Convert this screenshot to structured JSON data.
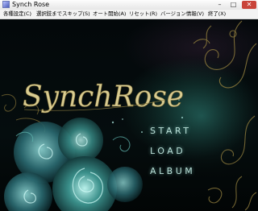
{
  "window": {
    "title": "Synch Rose",
    "controls": {
      "minimize": "–",
      "maximize": "□",
      "close": "✕"
    }
  },
  "menu": [
    "各種設定(C)",
    "選択肢までスキップ(S)",
    "オート開始(A)",
    "リセット(R)",
    "バージョン情報(V)",
    "終了(X)"
  ],
  "game": {
    "logo": "SynchRose",
    "options": {
      "start": "START",
      "load": "LOAD",
      "album": "ALBUM"
    }
  },
  "colors": {
    "logo_gold": "#d9cc92",
    "menu_text": "#b9ded6",
    "rose_teal": "#3a8f8a",
    "ornament_gold": "#8c7a3c"
  }
}
